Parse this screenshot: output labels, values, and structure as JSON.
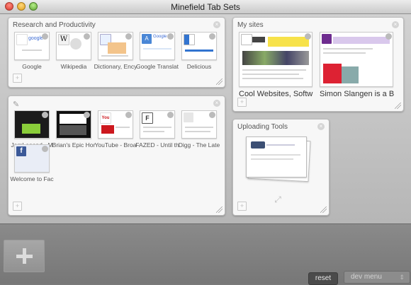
{
  "window": {
    "title": "Minefield Tab Sets"
  },
  "groups": [
    {
      "title": "Research and Productivity",
      "tabs": [
        "Google",
        "Wikipedia",
        "Dictionary, Ency",
        "Google Translat",
        "Delicious"
      ]
    },
    {
      "title": "My sites",
      "tabs": [
        "Cool Websites, Softw",
        "Simon Slangen is a B"
      ]
    },
    {
      "title": "",
      "tabs": [
        "JamLegend - M",
        "Brian's Epic Hor",
        "YouTube - Broa",
        "FAZED - Until th",
        "Digg - The Late",
        "Welcome to Fac"
      ]
    },
    {
      "title": "Uploading Tools",
      "tabs": []
    }
  ],
  "controls": {
    "reset_label": "reset",
    "dev_menu_label": "dev menu"
  },
  "colors": {
    "accent_youtube": "#cc181e",
    "facebook_blue": "#3b5998",
    "flickr_like": "#3b3b3b"
  },
  "icons": {
    "google": "google-favicon",
    "wikipedia": "wikipedia-favicon",
    "dictionary": "dictionary-favicon",
    "translate": "google-translate-favicon",
    "delicious": "delicious-favicon",
    "youtube": "youtube-favicon",
    "fazed": "fazed-favicon",
    "facebook": "facebook-favicon",
    "pencil": "edit-pencil-icon"
  }
}
